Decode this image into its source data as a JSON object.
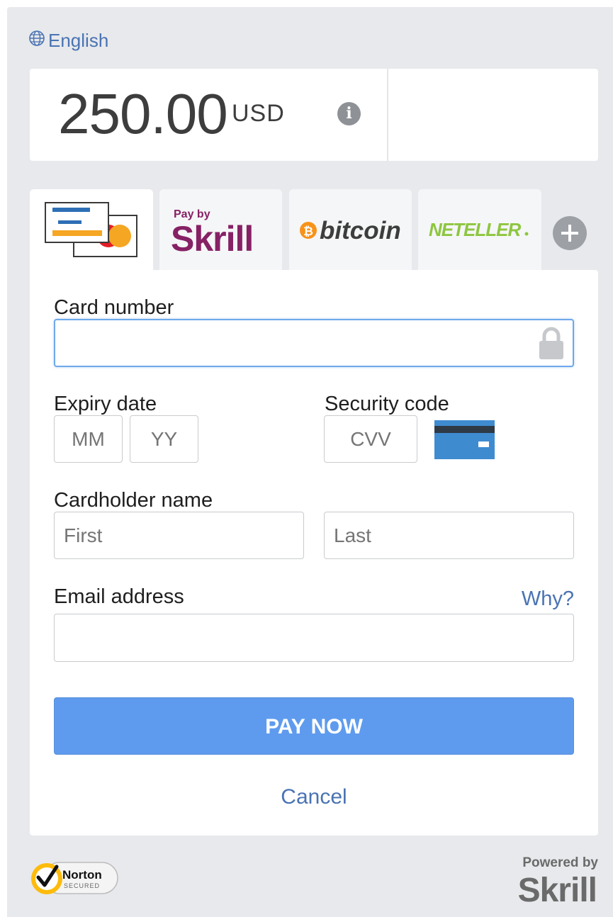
{
  "language": {
    "label": "English",
    "icon": "globe-icon"
  },
  "amount": {
    "value": "250.00",
    "currency": "USD",
    "info_icon": "info-icon"
  },
  "tabs": [
    {
      "id": "card",
      "icon": "credit-card-icon",
      "active": true
    },
    {
      "id": "skrill",
      "label_top": "Pay by",
      "label": "Skrill",
      "active": false
    },
    {
      "id": "bitcoin",
      "label": "bitcoin",
      "active": false
    },
    {
      "id": "neteller",
      "label": "NETELLER",
      "active": false
    },
    {
      "id": "more",
      "icon": "plus-icon",
      "active": false
    }
  ],
  "form": {
    "card_number": {
      "label": "Card number",
      "value": "",
      "icon": "lock-icon"
    },
    "expiry": {
      "label": "Expiry date",
      "mm_placeholder": "MM",
      "yy_placeholder": "YY"
    },
    "security": {
      "label": "Security code",
      "placeholder": "CVV",
      "icon": "card-back-icon"
    },
    "cardholder": {
      "label": "Cardholder name",
      "first_placeholder": "First",
      "last_placeholder": "Last"
    },
    "email": {
      "label": "Email address",
      "why_label": "Why?",
      "value": ""
    }
  },
  "pay_button": "PAY NOW",
  "cancel_label": "Cancel",
  "footer": {
    "norton_badge": {
      "brand": "Norton",
      "sub": "SECURED"
    },
    "powered_by": "Powered by",
    "powered_brand": "Skrill"
  },
  "colors": {
    "accent": "#5e9bee",
    "link": "#4a73b3",
    "skrill_purple": "#862165",
    "bitcoin_orange": "#f7931a",
    "neteller_green": "#8dc63f",
    "background": "#e7e9ec"
  }
}
